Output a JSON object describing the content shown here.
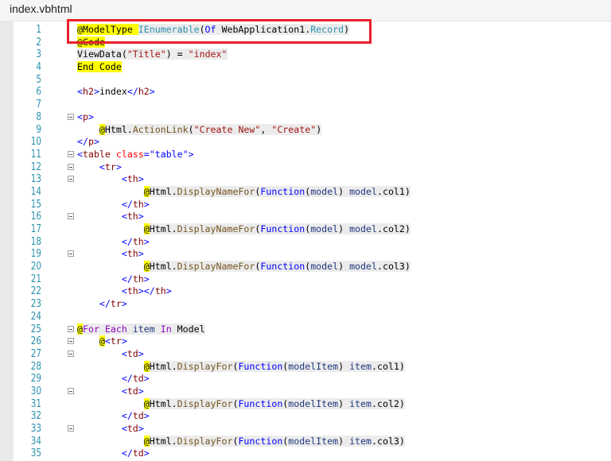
{
  "tab": {
    "title": "index.vbhtml"
  },
  "colors": {
    "highlight_box": "#e8202a",
    "line_numbers": "#2b91af",
    "razor_highlight": "#ffff00"
  },
  "lines": [
    {
      "n": "1",
      "indent": "",
      "shade": true,
      "seg": [
        [
          "@ModelType ",
          "rz"
        ],
        [
          "IEnumerable",
          "type"
        ],
        [
          "(",
          "p"
        ],
        [
          "Of",
          "kw"
        ],
        [
          " WebApplication1.",
          "p"
        ],
        [
          "Record",
          "type"
        ],
        [
          ")",
          "p"
        ]
      ]
    },
    {
      "n": "2",
      "indent": "",
      "seg": [
        [
          "@Code",
          "rz"
        ]
      ]
    },
    {
      "n": "3",
      "indent": "",
      "shade": true,
      "seg": [
        [
          "ViewData(",
          "p"
        ],
        [
          "\"Title\"",
          "str"
        ],
        [
          ") = ",
          "p"
        ],
        [
          "\"index\"",
          "str"
        ]
      ]
    },
    {
      "n": "4",
      "indent": "",
      "seg": [
        [
          "End Code",
          "rz"
        ]
      ]
    },
    {
      "n": "5",
      "indent": "",
      "seg": []
    },
    {
      "n": "6",
      "indent": "",
      "seg": [
        [
          "<",
          "tb"
        ],
        [
          "h2",
          "tn"
        ],
        [
          ">",
          "tb"
        ],
        [
          "index",
          "p"
        ],
        [
          "</",
          "tb"
        ],
        [
          "h2",
          "tn"
        ],
        [
          ">",
          "tb"
        ]
      ]
    },
    {
      "n": "7",
      "indent": "",
      "seg": []
    },
    {
      "n": "8",
      "indent": "",
      "fold": true,
      "seg": [
        [
          "<",
          "tb"
        ],
        [
          "p",
          "tn"
        ],
        [
          ">",
          "tb"
        ]
      ]
    },
    {
      "n": "9",
      "indent": "    ",
      "shade": true,
      "seg": [
        [
          "@",
          "rz"
        ],
        [
          "Html.",
          "p"
        ],
        [
          "ActionLink",
          "m"
        ],
        [
          "(",
          "p"
        ],
        [
          "\"Create New\"",
          "str"
        ],
        [
          ", ",
          "p"
        ],
        [
          "\"Create\"",
          "str"
        ],
        [
          ")",
          "p"
        ]
      ]
    },
    {
      "n": "10",
      "indent": "",
      "seg": [
        [
          "</",
          "tb"
        ],
        [
          "p",
          "tn"
        ],
        [
          ">",
          "tb"
        ]
      ]
    },
    {
      "n": "11",
      "indent": "",
      "fold": true,
      "seg": [
        [
          "<",
          "tb"
        ],
        [
          "table",
          "tn"
        ],
        [
          " ",
          "p"
        ],
        [
          "class",
          "at"
        ],
        [
          "=",
          "tb"
        ],
        [
          "\"table\"",
          "av"
        ],
        [
          ">",
          "tb"
        ]
      ]
    },
    {
      "n": "12",
      "indent": "    ",
      "fold": true,
      "seg": [
        [
          "<",
          "tb"
        ],
        [
          "tr",
          "tn"
        ],
        [
          ">",
          "tb"
        ]
      ]
    },
    {
      "n": "13",
      "indent": "        ",
      "fold": true,
      "seg": [
        [
          "<",
          "tb"
        ],
        [
          "th",
          "tn"
        ],
        [
          ">",
          "tb"
        ]
      ]
    },
    {
      "n": "14",
      "indent": "            ",
      "shade": true,
      "seg": [
        [
          "@",
          "rz"
        ],
        [
          "Html.",
          "p"
        ],
        [
          "DisplayNameFor",
          "m"
        ],
        [
          "(",
          "p"
        ],
        [
          "Function",
          "kw"
        ],
        [
          "(",
          "p"
        ],
        [
          "model",
          "pa"
        ],
        [
          ") ",
          "p"
        ],
        [
          "model",
          "pa"
        ],
        [
          ".col1)",
          "p"
        ]
      ]
    },
    {
      "n": "15",
      "indent": "        ",
      "seg": [
        [
          "</",
          "tb"
        ],
        [
          "th",
          "tn"
        ],
        [
          ">",
          "tb"
        ]
      ]
    },
    {
      "n": "16",
      "indent": "        ",
      "fold": true,
      "seg": [
        [
          "<",
          "tb"
        ],
        [
          "th",
          "tn"
        ],
        [
          ">",
          "tb"
        ]
      ]
    },
    {
      "n": "17",
      "indent": "            ",
      "shade": true,
      "seg": [
        [
          "@",
          "rz"
        ],
        [
          "Html.",
          "p"
        ],
        [
          "DisplayNameFor",
          "m"
        ],
        [
          "(",
          "p"
        ],
        [
          "Function",
          "kw"
        ],
        [
          "(",
          "p"
        ],
        [
          "model",
          "pa"
        ],
        [
          ") ",
          "p"
        ],
        [
          "model",
          "pa"
        ],
        [
          ".col2)",
          "p"
        ]
      ]
    },
    {
      "n": "18",
      "indent": "        ",
      "seg": [
        [
          "</",
          "tb"
        ],
        [
          "th",
          "tn"
        ],
        [
          ">",
          "tb"
        ]
      ]
    },
    {
      "n": "19",
      "indent": "        ",
      "fold": true,
      "seg": [
        [
          "<",
          "tb"
        ],
        [
          "th",
          "tn"
        ],
        [
          ">",
          "tb"
        ]
      ]
    },
    {
      "n": "20",
      "indent": "            ",
      "shade": true,
      "seg": [
        [
          "@",
          "rz"
        ],
        [
          "Html.",
          "p"
        ],
        [
          "DisplayNameFor",
          "m"
        ],
        [
          "(",
          "p"
        ],
        [
          "Function",
          "kw"
        ],
        [
          "(",
          "p"
        ],
        [
          "model",
          "pa"
        ],
        [
          ") ",
          "p"
        ],
        [
          "model",
          "pa"
        ],
        [
          ".col3)",
          "p"
        ]
      ]
    },
    {
      "n": "21",
      "indent": "        ",
      "seg": [
        [
          "</",
          "tb"
        ],
        [
          "th",
          "tn"
        ],
        [
          ">",
          "tb"
        ]
      ]
    },
    {
      "n": "22",
      "indent": "        ",
      "seg": [
        [
          "<",
          "tb"
        ],
        [
          "th",
          "tn"
        ],
        [
          "></",
          "tb"
        ],
        [
          "th",
          "tn"
        ],
        [
          ">",
          "tb"
        ]
      ]
    },
    {
      "n": "23",
      "indent": "    ",
      "seg": [
        [
          "</",
          "tb"
        ],
        [
          "tr",
          "tn"
        ],
        [
          ">",
          "tb"
        ]
      ]
    },
    {
      "n": "24",
      "indent": "",
      "seg": []
    },
    {
      "n": "25",
      "indent": "",
      "fold": true,
      "shade": true,
      "seg": [
        [
          "@",
          "rz"
        ],
        [
          "For Each",
          "ctl"
        ],
        [
          " item ",
          "pa"
        ],
        [
          "In",
          "ctl"
        ],
        [
          " Model",
          "p"
        ]
      ]
    },
    {
      "n": "26",
      "indent": "    ",
      "fold": true,
      "seg": [
        [
          "@",
          "rz"
        ],
        [
          "<",
          "tb"
        ],
        [
          "tr",
          "tn"
        ],
        [
          ">",
          "tb"
        ]
      ]
    },
    {
      "n": "27",
      "indent": "        ",
      "fold": true,
      "seg": [
        [
          "<",
          "tb"
        ],
        [
          "td",
          "tn"
        ],
        [
          ">",
          "tb"
        ]
      ]
    },
    {
      "n": "28",
      "indent": "            ",
      "shade": true,
      "seg": [
        [
          "@",
          "rz"
        ],
        [
          "Html.",
          "p"
        ],
        [
          "DisplayFor",
          "m"
        ],
        [
          "(",
          "p"
        ],
        [
          "Function",
          "kw"
        ],
        [
          "(",
          "p"
        ],
        [
          "modelItem",
          "pa"
        ],
        [
          ") ",
          "p"
        ],
        [
          "item",
          "pa"
        ],
        [
          ".col1)",
          "p"
        ]
      ]
    },
    {
      "n": "29",
      "indent": "        ",
      "seg": [
        [
          "</",
          "tb"
        ],
        [
          "td",
          "tn"
        ],
        [
          ">",
          "tb"
        ]
      ]
    },
    {
      "n": "30",
      "indent": "        ",
      "fold": true,
      "seg": [
        [
          "<",
          "tb"
        ],
        [
          "td",
          "tn"
        ],
        [
          ">",
          "tb"
        ]
      ]
    },
    {
      "n": "31",
      "indent": "            ",
      "shade": true,
      "seg": [
        [
          "@",
          "rz"
        ],
        [
          "Html.",
          "p"
        ],
        [
          "DisplayFor",
          "m"
        ],
        [
          "(",
          "p"
        ],
        [
          "Function",
          "kw"
        ],
        [
          "(",
          "p"
        ],
        [
          "modelItem",
          "pa"
        ],
        [
          ") ",
          "p"
        ],
        [
          "item",
          "pa"
        ],
        [
          ".col2)",
          "p"
        ]
      ]
    },
    {
      "n": "32",
      "indent": "        ",
      "seg": [
        [
          "</",
          "tb"
        ],
        [
          "td",
          "tn"
        ],
        [
          ">",
          "tb"
        ]
      ]
    },
    {
      "n": "33",
      "indent": "        ",
      "fold": true,
      "seg": [
        [
          "<",
          "tb"
        ],
        [
          "td",
          "tn"
        ],
        [
          ">",
          "tb"
        ]
      ]
    },
    {
      "n": "34",
      "indent": "            ",
      "shade": true,
      "seg": [
        [
          "@",
          "rz"
        ],
        [
          "Html.",
          "p"
        ],
        [
          "DisplayFor",
          "m"
        ],
        [
          "(",
          "p"
        ],
        [
          "Function",
          "kw"
        ],
        [
          "(",
          "p"
        ],
        [
          "modelItem",
          "pa"
        ],
        [
          ") ",
          "p"
        ],
        [
          "item",
          "pa"
        ],
        [
          ".col3)",
          "p"
        ]
      ]
    },
    {
      "n": "35",
      "indent": "        ",
      "seg": [
        [
          "</",
          "tb"
        ],
        [
          "td",
          "tn"
        ],
        [
          ">",
          "tb"
        ]
      ]
    }
  ]
}
